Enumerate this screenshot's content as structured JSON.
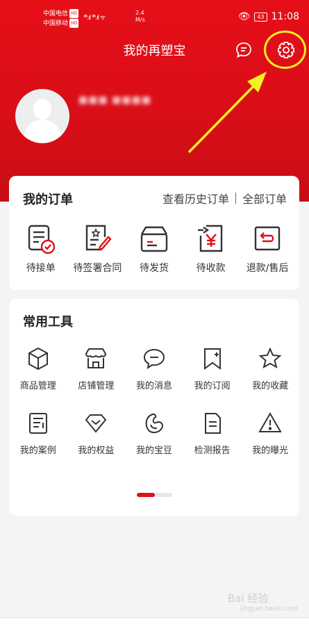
{
  "status_bar": {
    "carrier1": "中国电信",
    "carrier2": "中国移动",
    "hd": "HD",
    "speed_value": "2.4",
    "speed_unit": "M/s",
    "battery": "43",
    "time": "11:08"
  },
  "header": {
    "title": "我的再塑宝",
    "message_icon": "chat-bubble-icon",
    "settings_icon": "gear-icon",
    "username": "■■■ ■■■■"
  },
  "orders": {
    "title": "我的订单",
    "history_link": "查看历史订单",
    "all_link": "全部订单",
    "items": [
      {
        "label": "待接单",
        "icon": "pending-order-icon"
      },
      {
        "label": "待签署合同",
        "icon": "contract-sign-icon"
      },
      {
        "label": "待发货",
        "icon": "shipping-box-icon"
      },
      {
        "label": "待收款",
        "icon": "payment-yen-icon"
      },
      {
        "label": "退款/售后",
        "icon": "refund-return-icon"
      }
    ]
  },
  "tools": {
    "title": "常用工具",
    "items": [
      {
        "label": "商品管理",
        "icon": "cube-icon"
      },
      {
        "label": "店铺管理",
        "icon": "store-icon"
      },
      {
        "label": "我的消息",
        "icon": "speech-bubble-icon"
      },
      {
        "label": "我的订阅",
        "icon": "bookmark-icon"
      },
      {
        "label": "我的收藏",
        "icon": "star-icon"
      },
      {
        "label": "我的案例",
        "icon": "case-list-icon"
      },
      {
        "label": "我的权益",
        "icon": "diamond-icon"
      },
      {
        "label": "我的宝豆",
        "icon": "bean-icon"
      },
      {
        "label": "检测报告",
        "icon": "report-icon"
      },
      {
        "label": "我的曝光",
        "icon": "warning-icon"
      }
    ],
    "page_indicator": {
      "current": 1,
      "total": 2
    }
  },
  "watermark": {
    "text": "Bai  经验",
    "sub": "jingyan.baidu.com"
  },
  "colors": {
    "brand_red": "#e10f18",
    "highlight": "#f5f021"
  }
}
